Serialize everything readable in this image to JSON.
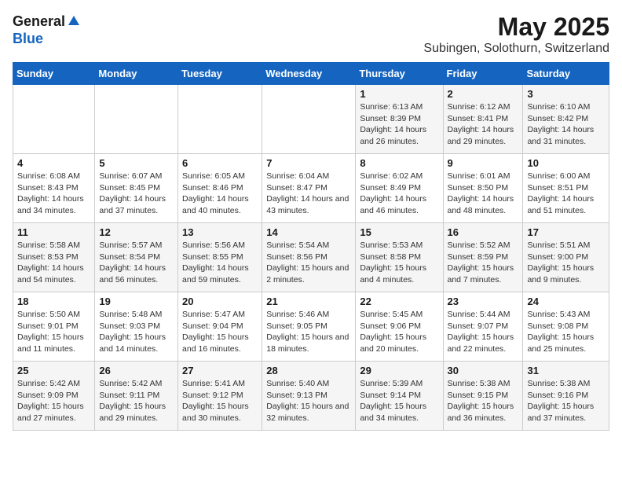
{
  "header": {
    "logo_general": "General",
    "logo_blue": "Blue",
    "title": "May 2025",
    "subtitle": "Subingen, Solothurn, Switzerland"
  },
  "days_of_week": [
    "Sunday",
    "Monday",
    "Tuesday",
    "Wednesday",
    "Thursday",
    "Friday",
    "Saturday"
  ],
  "weeks": [
    [
      {
        "num": "",
        "text": ""
      },
      {
        "num": "",
        "text": ""
      },
      {
        "num": "",
        "text": ""
      },
      {
        "num": "",
        "text": ""
      },
      {
        "num": "1",
        "text": "Sunrise: 6:13 AM\nSunset: 8:39 PM\nDaylight: 14 hours and 26 minutes."
      },
      {
        "num": "2",
        "text": "Sunrise: 6:12 AM\nSunset: 8:41 PM\nDaylight: 14 hours and 29 minutes."
      },
      {
        "num": "3",
        "text": "Sunrise: 6:10 AM\nSunset: 8:42 PM\nDaylight: 14 hours and 31 minutes."
      }
    ],
    [
      {
        "num": "4",
        "text": "Sunrise: 6:08 AM\nSunset: 8:43 PM\nDaylight: 14 hours and 34 minutes."
      },
      {
        "num": "5",
        "text": "Sunrise: 6:07 AM\nSunset: 8:45 PM\nDaylight: 14 hours and 37 minutes."
      },
      {
        "num": "6",
        "text": "Sunrise: 6:05 AM\nSunset: 8:46 PM\nDaylight: 14 hours and 40 minutes."
      },
      {
        "num": "7",
        "text": "Sunrise: 6:04 AM\nSunset: 8:47 PM\nDaylight: 14 hours and 43 minutes."
      },
      {
        "num": "8",
        "text": "Sunrise: 6:02 AM\nSunset: 8:49 PM\nDaylight: 14 hours and 46 minutes."
      },
      {
        "num": "9",
        "text": "Sunrise: 6:01 AM\nSunset: 8:50 PM\nDaylight: 14 hours and 48 minutes."
      },
      {
        "num": "10",
        "text": "Sunrise: 6:00 AM\nSunset: 8:51 PM\nDaylight: 14 hours and 51 minutes."
      }
    ],
    [
      {
        "num": "11",
        "text": "Sunrise: 5:58 AM\nSunset: 8:53 PM\nDaylight: 14 hours and 54 minutes."
      },
      {
        "num": "12",
        "text": "Sunrise: 5:57 AM\nSunset: 8:54 PM\nDaylight: 14 hours and 56 minutes."
      },
      {
        "num": "13",
        "text": "Sunrise: 5:56 AM\nSunset: 8:55 PM\nDaylight: 14 hours and 59 minutes."
      },
      {
        "num": "14",
        "text": "Sunrise: 5:54 AM\nSunset: 8:56 PM\nDaylight: 15 hours and 2 minutes."
      },
      {
        "num": "15",
        "text": "Sunrise: 5:53 AM\nSunset: 8:58 PM\nDaylight: 15 hours and 4 minutes."
      },
      {
        "num": "16",
        "text": "Sunrise: 5:52 AM\nSunset: 8:59 PM\nDaylight: 15 hours and 7 minutes."
      },
      {
        "num": "17",
        "text": "Sunrise: 5:51 AM\nSunset: 9:00 PM\nDaylight: 15 hours and 9 minutes."
      }
    ],
    [
      {
        "num": "18",
        "text": "Sunrise: 5:50 AM\nSunset: 9:01 PM\nDaylight: 15 hours and 11 minutes."
      },
      {
        "num": "19",
        "text": "Sunrise: 5:48 AM\nSunset: 9:03 PM\nDaylight: 15 hours and 14 minutes."
      },
      {
        "num": "20",
        "text": "Sunrise: 5:47 AM\nSunset: 9:04 PM\nDaylight: 15 hours and 16 minutes."
      },
      {
        "num": "21",
        "text": "Sunrise: 5:46 AM\nSunset: 9:05 PM\nDaylight: 15 hours and 18 minutes."
      },
      {
        "num": "22",
        "text": "Sunrise: 5:45 AM\nSunset: 9:06 PM\nDaylight: 15 hours and 20 minutes."
      },
      {
        "num": "23",
        "text": "Sunrise: 5:44 AM\nSunset: 9:07 PM\nDaylight: 15 hours and 22 minutes."
      },
      {
        "num": "24",
        "text": "Sunrise: 5:43 AM\nSunset: 9:08 PM\nDaylight: 15 hours and 25 minutes."
      }
    ],
    [
      {
        "num": "25",
        "text": "Sunrise: 5:42 AM\nSunset: 9:09 PM\nDaylight: 15 hours and 27 minutes."
      },
      {
        "num": "26",
        "text": "Sunrise: 5:42 AM\nSunset: 9:11 PM\nDaylight: 15 hours and 29 minutes."
      },
      {
        "num": "27",
        "text": "Sunrise: 5:41 AM\nSunset: 9:12 PM\nDaylight: 15 hours and 30 minutes."
      },
      {
        "num": "28",
        "text": "Sunrise: 5:40 AM\nSunset: 9:13 PM\nDaylight: 15 hours and 32 minutes."
      },
      {
        "num": "29",
        "text": "Sunrise: 5:39 AM\nSunset: 9:14 PM\nDaylight: 15 hours and 34 minutes."
      },
      {
        "num": "30",
        "text": "Sunrise: 5:38 AM\nSunset: 9:15 PM\nDaylight: 15 hours and 36 minutes."
      },
      {
        "num": "31",
        "text": "Sunrise: 5:38 AM\nSunset: 9:16 PM\nDaylight: 15 hours and 37 minutes."
      }
    ]
  ]
}
